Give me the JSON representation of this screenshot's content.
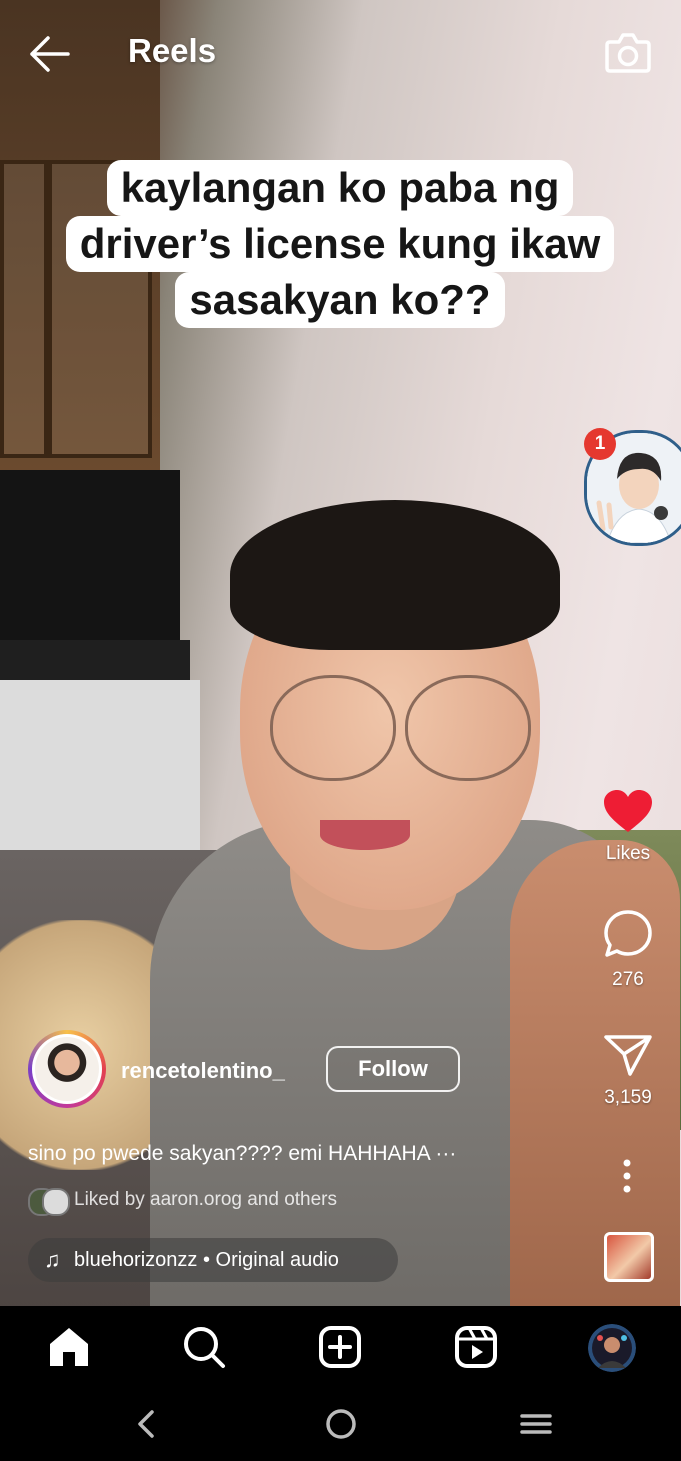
{
  "header": {
    "title": "Reels"
  },
  "caption_lines": [
    "kaylangan ko paba ng",
    "driver’s license kung ikaw",
    "sasakyan ko??"
  ],
  "notification": {
    "badge_count": "1"
  },
  "actions": {
    "likes_label": "Likes",
    "comments_count": "276",
    "shares_count": "3,159"
  },
  "post": {
    "username": "rencetolentino_",
    "follow_label": "Follow",
    "description": "sino po pwede sakyan???? emi HAHHAHA ···",
    "liked_by": "Liked by aaron.orog and others",
    "audio": "bluehorizonzz • Original audio"
  },
  "colors": {
    "like_red": "#ee1d34",
    "badge_red": "#e5382f"
  },
  "icons": {
    "back": "back-arrow-icon",
    "camera": "camera-icon",
    "like": "heart-icon",
    "comment": "comment-bubble-icon",
    "share": "send-icon",
    "more": "more-vertical-icon",
    "music": "music-note-icon",
    "home": "home-icon",
    "search": "search-icon",
    "create": "create-plus-icon",
    "reels": "reels-icon"
  }
}
